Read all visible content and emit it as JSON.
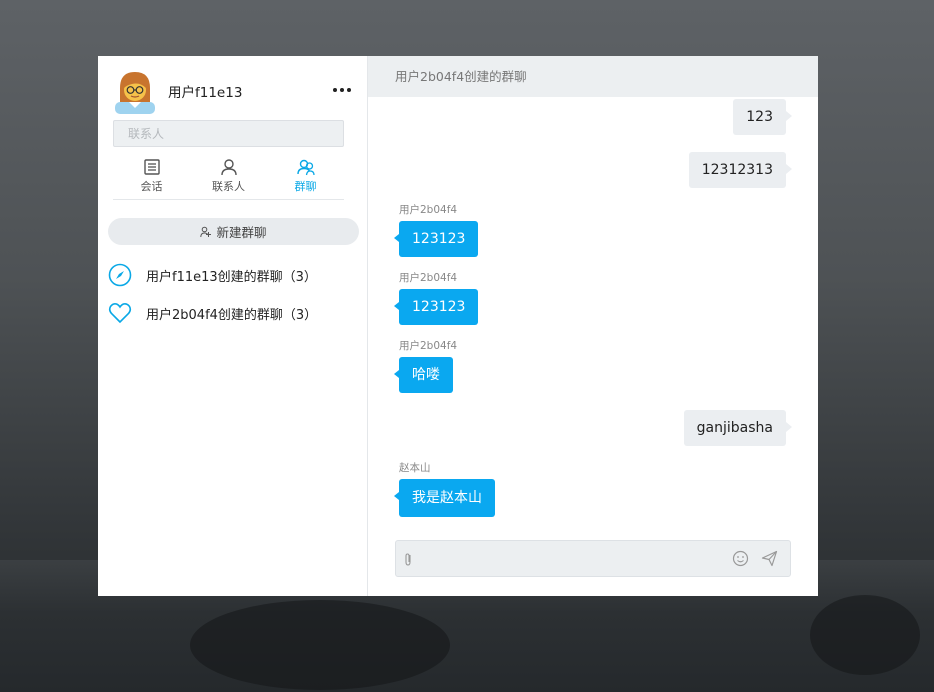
{
  "profile": {
    "username": "用户f11e13"
  },
  "search": {
    "placeholder": "联系人"
  },
  "tabs": [
    {
      "label": "会话",
      "icon": "conversation-icon",
      "active": false
    },
    {
      "label": "联系人",
      "icon": "contact-icon",
      "active": false
    },
    {
      "label": "群聊",
      "icon": "group-chat-icon",
      "active": true
    }
  ],
  "new_group": {
    "label": "新建群聊",
    "icon": "add-group-icon"
  },
  "groups": [
    {
      "name": "用户f11e13创建的群聊（3）",
      "icon": "compass-icon"
    },
    {
      "name": "用户2b04f4创建的群聊（3）",
      "icon": "heart-icon"
    }
  ],
  "chat": {
    "title": "用户2b04f4创建的群聊",
    "messages": [
      {
        "from_me": true,
        "sender": "",
        "text": "123"
      },
      {
        "from_me": true,
        "sender": "",
        "text": "12312313"
      },
      {
        "from_me": false,
        "sender": "用户2b04f4",
        "text": "123123"
      },
      {
        "from_me": false,
        "sender": "用户2b04f4",
        "text": "123123"
      },
      {
        "from_me": false,
        "sender": "用户2b04f4",
        "text": "哈喽"
      },
      {
        "from_me": true,
        "sender": "",
        "text": "ganjibasha"
      },
      {
        "from_me": false,
        "sender": "赵本山",
        "text": "我是赵本山"
      }
    ]
  },
  "input": {
    "placeholder": "",
    "value": "",
    "icons": [
      "attach-icon",
      "emoji-icon",
      "send-icon"
    ]
  },
  "colors": {
    "accent": "#0aa8f0",
    "my_bubble": "#ebeef1",
    "header_bg": "#eceff1"
  }
}
